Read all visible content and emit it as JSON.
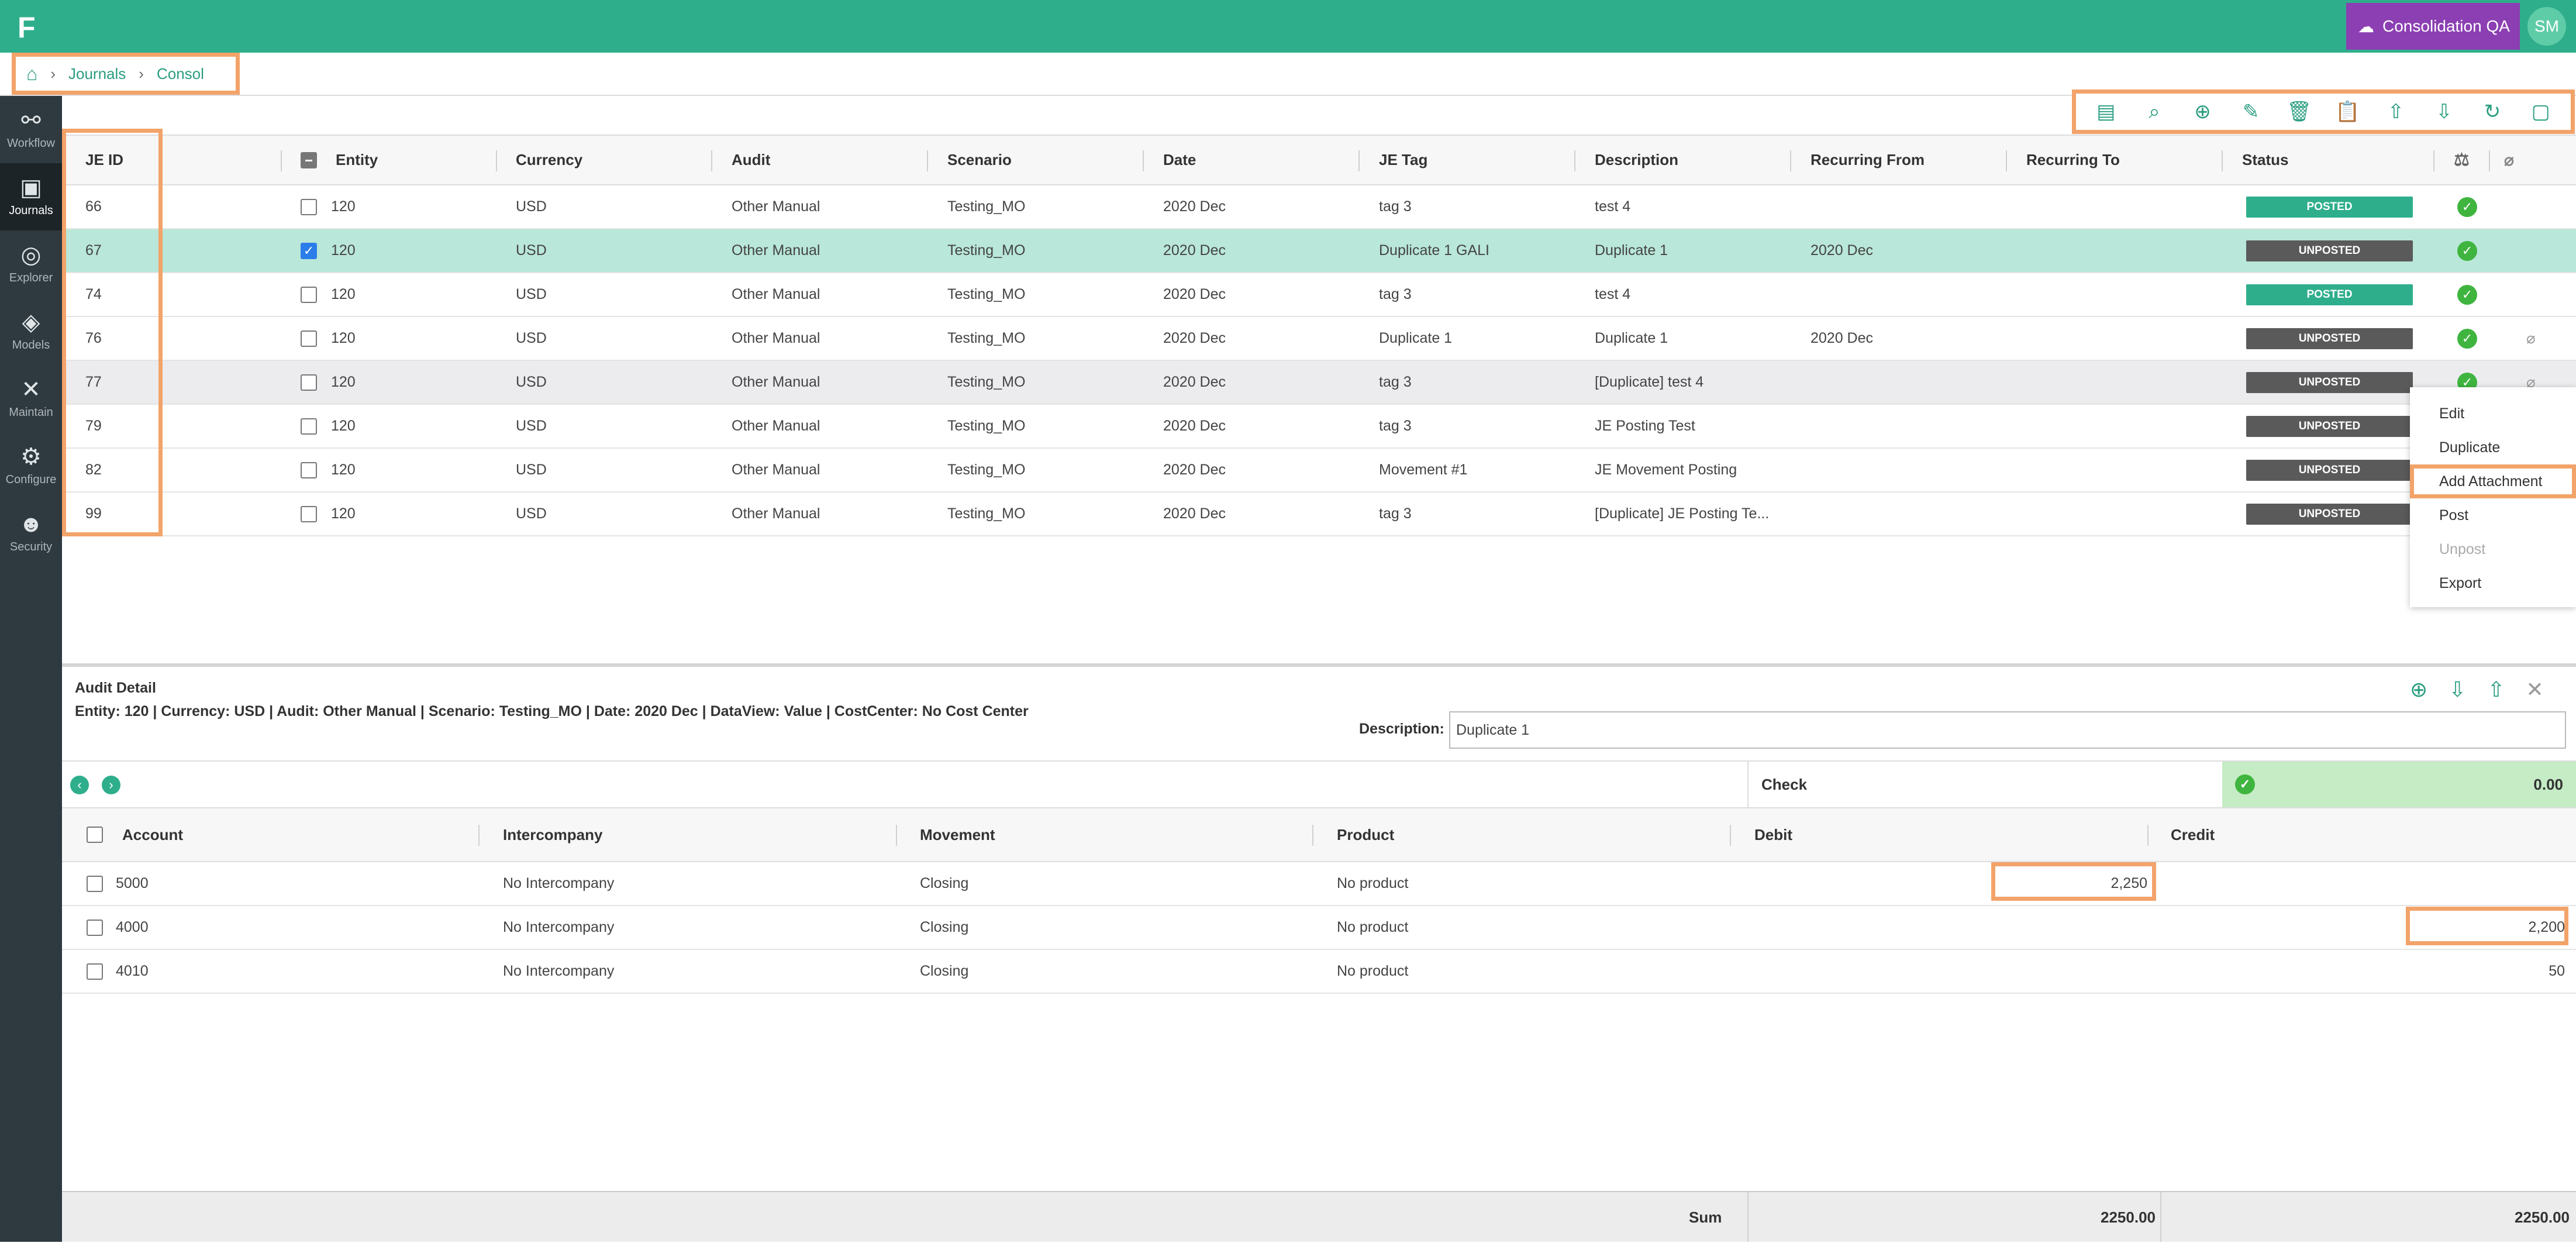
{
  "app": {
    "logo": "F",
    "app_name": "Consolidation QA",
    "user_initials": "SM"
  },
  "breadcrumb": {
    "items": [
      "Journals",
      "Consol"
    ]
  },
  "sidebar": {
    "items": [
      {
        "label": "Workflow",
        "icon": "workflow-icon"
      },
      {
        "label": "Journals",
        "icon": "journals-icon"
      },
      {
        "label": "Explorer",
        "icon": "compass-icon"
      },
      {
        "label": "Models",
        "icon": "layers-icon"
      },
      {
        "label": "Maintain",
        "icon": "tools-icon"
      },
      {
        "label": "Configure",
        "icon": "gear-icon"
      },
      {
        "label": "Security",
        "icon": "users-icon"
      }
    ]
  },
  "toolbar": {
    "icons": [
      "view-details-icon",
      "search-icon",
      "add-icon",
      "edit-icon",
      "delete-icon",
      "clipboard-icon",
      "upload-icon",
      "download-icon",
      "refresh-icon",
      "save-icon"
    ]
  },
  "grid": {
    "columns": [
      "JE ID",
      "Entity",
      "Currency",
      "Audit",
      "Scenario",
      "Date",
      "JE Tag",
      "Description",
      "Recurring From",
      "Recurring To",
      "Status"
    ],
    "rows": [
      {
        "id": "66",
        "entity": "120",
        "currency": "USD",
        "audit": "Other Manual",
        "scenario": "Testing_MO",
        "date": "2020 Dec",
        "tag": "tag 3",
        "description": "test 4",
        "rec_from": "",
        "rec_to": "",
        "status": "POSTED",
        "checked": false
      },
      {
        "id": "67",
        "entity": "120",
        "currency": "USD",
        "audit": "Other Manual",
        "scenario": "Testing_MO",
        "date": "2020 Dec",
        "tag": "Duplicate 1 GALI",
        "description": "Duplicate 1",
        "rec_from": "2020 Dec",
        "rec_to": "",
        "status": "UNPOSTED",
        "checked": true
      },
      {
        "id": "74",
        "entity": "120",
        "currency": "USD",
        "audit": "Other Manual",
        "scenario": "Testing_MO",
        "date": "2020 Dec",
        "tag": "tag 3",
        "description": "test 4",
        "rec_from": "",
        "rec_to": "",
        "status": "POSTED",
        "checked": false
      },
      {
        "id": "76",
        "entity": "120",
        "currency": "USD",
        "audit": "Other Manual",
        "scenario": "Testing_MO",
        "date": "2020 Dec",
        "tag": "Duplicate 1",
        "description": "Duplicate 1",
        "rec_from": "2020 Dec",
        "rec_to": "",
        "status": "UNPOSTED",
        "checked": false
      },
      {
        "id": "77",
        "entity": "120",
        "currency": "USD",
        "audit": "Other Manual",
        "scenario": "Testing_MO",
        "date": "2020 Dec",
        "tag": "tag 3",
        "description": "[Duplicate] test 4",
        "rec_from": "",
        "rec_to": "",
        "status": "UNPOSTED",
        "checked": false
      },
      {
        "id": "79",
        "entity": "120",
        "currency": "USD",
        "audit": "Other Manual",
        "scenario": "Testing_MO",
        "date": "2020 Dec",
        "tag": "tag 3",
        "description": "JE Posting Test",
        "rec_from": "",
        "rec_to": "",
        "status": "UNPOSTED",
        "checked": false
      },
      {
        "id": "82",
        "entity": "120",
        "currency": "USD",
        "audit": "Other Manual",
        "scenario": "Testing_MO",
        "date": "2020 Dec",
        "tag": "Movement #1",
        "description": "JE Movement Posting",
        "rec_from": "",
        "rec_to": "",
        "status": "UNPOSTED",
        "checked": false
      },
      {
        "id": "99",
        "entity": "120",
        "currency": "USD",
        "audit": "Other Manual",
        "scenario": "Testing_MO",
        "date": "2020 Dec",
        "tag": "tag 3",
        "description": "[Duplicate] JE Posting Te...",
        "rec_from": "",
        "rec_to": "",
        "status": "UNPOSTED",
        "checked": false
      }
    ]
  },
  "context_menu": {
    "items": [
      {
        "label": "Edit",
        "disabled": false
      },
      {
        "label": "Duplicate",
        "disabled": false
      },
      {
        "label": "Add Attachment",
        "disabled": false
      },
      {
        "label": "Post",
        "disabled": false
      },
      {
        "label": "Unpost",
        "disabled": true
      },
      {
        "label": "Export",
        "disabled": false
      }
    ]
  },
  "audit_detail": {
    "title": "Audit Detail",
    "info": "Entity: 120 |  Currency: USD |  Audit: Other Manual |  Scenario: Testing_MO |  Date: 2020 Dec |  DataView: Value |  CostCenter: No Cost Center",
    "description_label": "Description:",
    "description_value": "Duplicate 1"
  },
  "check": {
    "label": "Check",
    "value": "0.00"
  },
  "lines": {
    "columns": [
      "Account",
      "Intercompany",
      "Movement",
      "Product",
      "Debit",
      "Credit"
    ],
    "rows": [
      {
        "account": "5000",
        "intercompany": "No Intercompany",
        "movement": "Closing",
        "product": "No product",
        "debit": "2,250",
        "credit": ""
      },
      {
        "account": "4000",
        "intercompany": "No Intercompany",
        "movement": "Closing",
        "product": "No product",
        "debit": "",
        "credit": "2,200"
      },
      {
        "account": "4010",
        "intercompany": "No Intercompany",
        "movement": "Closing",
        "product": "No product",
        "debit": "",
        "credit": "50"
      }
    ]
  },
  "sum": {
    "label": "Sum",
    "debit": "2250.00",
    "credit": "2250.00"
  },
  "colors": {
    "brand": "#2fae8c",
    "app_button": "#8b3fb2",
    "highlight": "#f2a36a",
    "posted": "#2fae8c",
    "unposted": "#5a5a5a"
  }
}
